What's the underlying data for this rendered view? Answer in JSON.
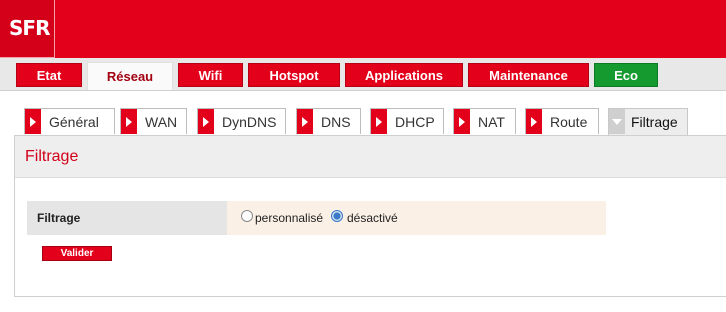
{
  "brand": {
    "logo_text": "SFR"
  },
  "main_nav": [
    {
      "label": "Etat"
    },
    {
      "label": "Réseau"
    },
    {
      "label": "Wifi"
    },
    {
      "label": "Hotspot"
    },
    {
      "label": "Applications"
    },
    {
      "label": "Maintenance"
    },
    {
      "label": "Eco"
    }
  ],
  "sub_nav": [
    {
      "label": "Général"
    },
    {
      "label": "WAN"
    },
    {
      "label": "DynDNS"
    },
    {
      "label": "DNS"
    },
    {
      "label": "DHCP"
    },
    {
      "label": "NAT"
    },
    {
      "label": "Route"
    },
    {
      "label": "Filtrage"
    }
  ],
  "active_main_tab": "Réseau",
  "active_sub_tab": "Filtrage",
  "panel": {
    "title": "Filtrage",
    "field_label": "Filtrage",
    "options": [
      {
        "label": "personnalisé",
        "checked": false
      },
      {
        "label": "désactivé",
        "checked": true
      }
    ],
    "submit_label": "Valider"
  },
  "colors": {
    "brand_red": "#e2001a",
    "eco_green": "#149a2e",
    "radio_selected": "#3a78c8"
  }
}
